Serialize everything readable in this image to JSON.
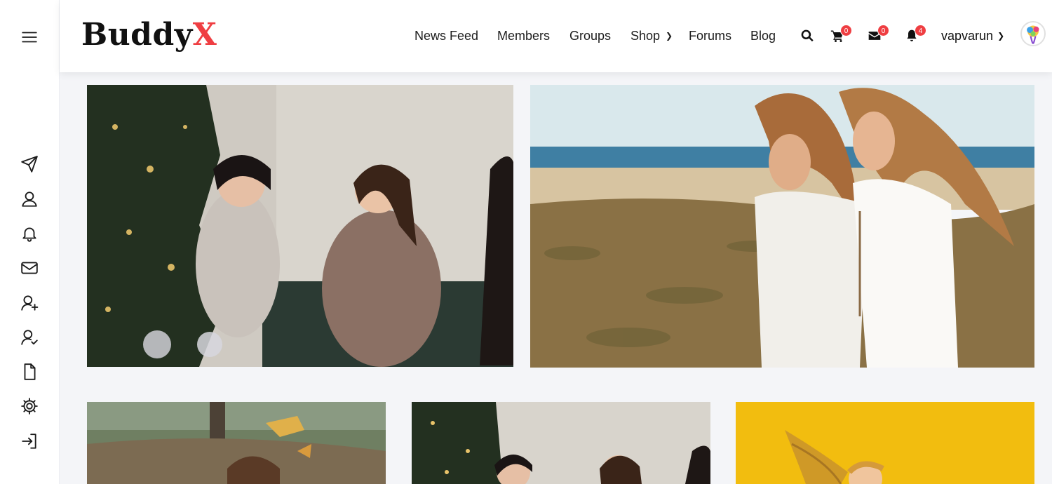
{
  "brand": {
    "logo_main": "Buddy",
    "logo_accent": "X",
    "accent_color": "#ef3e42"
  },
  "nav": {
    "items": [
      {
        "label": "News Feed"
      },
      {
        "label": "Members"
      },
      {
        "label": "Groups"
      },
      {
        "label": "Shop",
        "has_dropdown": true
      },
      {
        "label": "Forums"
      },
      {
        "label": "Blog"
      }
    ]
  },
  "header_icons": {
    "search": "search-icon",
    "cart": {
      "icon": "cart-icon",
      "count": "0"
    },
    "messages": {
      "icon": "envelope-icon",
      "count": "0"
    },
    "notifications": {
      "icon": "bell-icon",
      "count": "4"
    }
  },
  "user": {
    "username": "vapvarun"
  },
  "sidebar_icons": [
    "menu-icon",
    "paper-plane-icon",
    "user-icon",
    "bell-icon",
    "envelope-icon",
    "user-plus-icon",
    "user-check-icon",
    "file-icon",
    "gear-icon",
    "login-icon"
  ],
  "photos": [
    {
      "subject": "party-women-christmas-tree"
    },
    {
      "subject": "two-women-beach-grass"
    },
    {
      "subject": "woman-autumn-leaves"
    },
    {
      "subject": "party-women-christmas-tree"
    },
    {
      "subject": "woman-yellow-background"
    }
  ]
}
